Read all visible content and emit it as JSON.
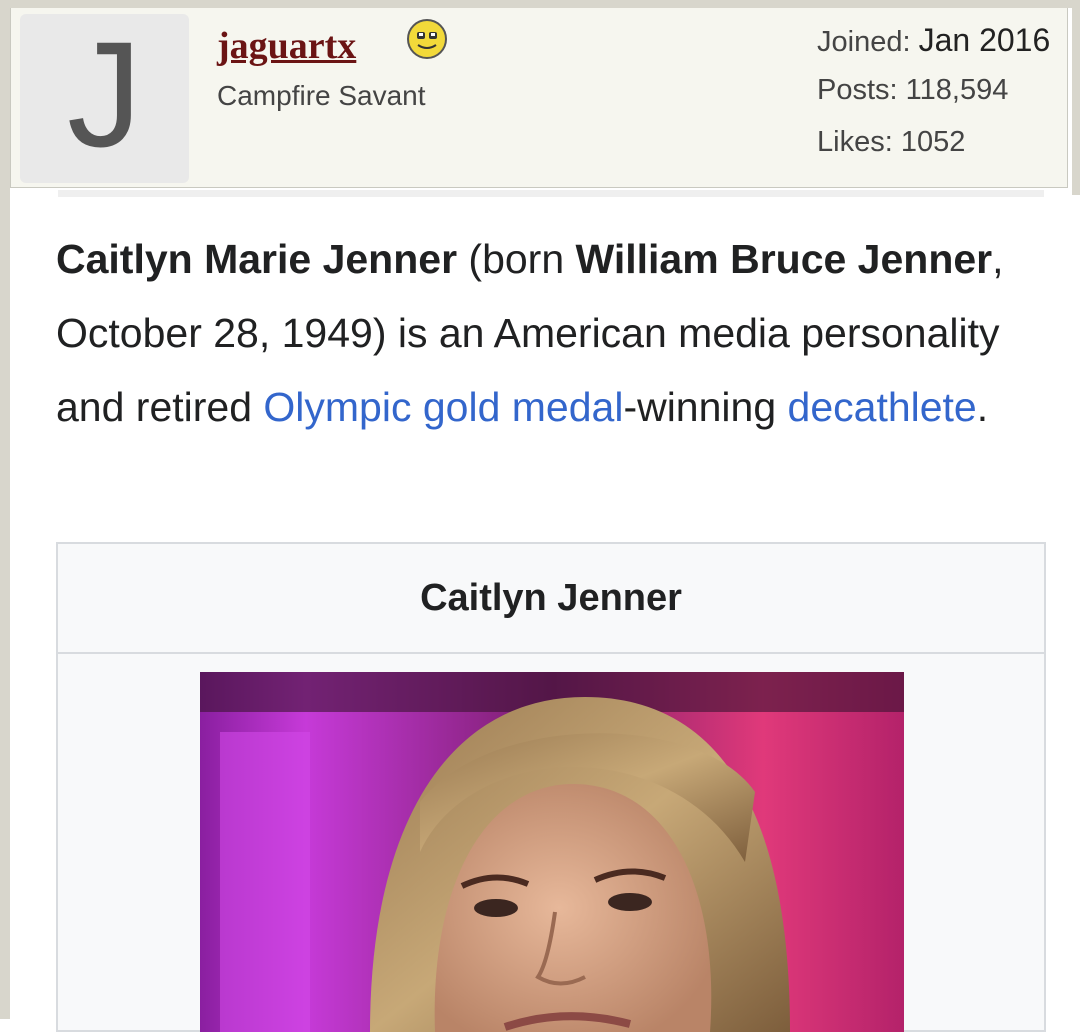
{
  "user": {
    "avatar_letter": "J",
    "username": "jaguartx",
    "title": "Campfire Savant",
    "status_icon": "smiley-face-icon",
    "stats": {
      "joined_label": "Joined:",
      "joined_value": "Jan 2016",
      "posts_label": "Posts:",
      "posts_value": "118,594",
      "likes_label": "Likes:",
      "likes_value": "1052"
    }
  },
  "article": {
    "name_bold": "Caitlyn Marie Jenner",
    "born_prefix": " (born ",
    "birth_name": "William Bruce Jenner",
    "text_1": ", October 28, 1949) is an American media personality and retired ",
    "link_1": "Olympic gold medal",
    "text_2": "-winning ",
    "link_2": "decathlete",
    "text_3": "."
  },
  "infobox": {
    "title": "Caitlyn Jenner"
  },
  "colors": {
    "username": "#6b1414",
    "link": "#3366cc",
    "header_bg": "#f6f6ef"
  }
}
